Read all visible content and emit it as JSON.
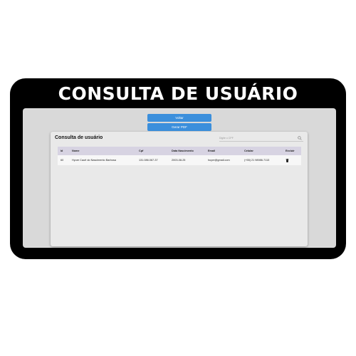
{
  "banner": {
    "title": "CONSULTA DE USUÁRIO"
  },
  "toolbar": {
    "voltar_label": "Voltar",
    "pdf_label": "Gerar PDF"
  },
  "card": {
    "title": "Consulta de usuário",
    "search_placeholder": "Digite o CPF"
  },
  "table": {
    "headers": [
      "Id",
      "Nome",
      "Cpf",
      "Data Nascimento",
      "Email",
      "Celular",
      "Excluir"
    ],
    "rows": [
      {
        "id": "60",
        "nome": "Hyure Cauê do Nascimento Barbosa",
        "cpf": "131.086.067-37",
        "nascimento": "2003-08-25",
        "email": "huyre@gmail.com",
        "celular": "(+55) 21 98986-7113",
        "excluir_icon": "trash-icon"
      }
    ]
  },
  "colors": {
    "frame": "#000000",
    "button": "#3b8fdc",
    "header_row": "#d7d3e2",
    "card": "#e9e9e9",
    "screen": "#d9d9d9"
  }
}
